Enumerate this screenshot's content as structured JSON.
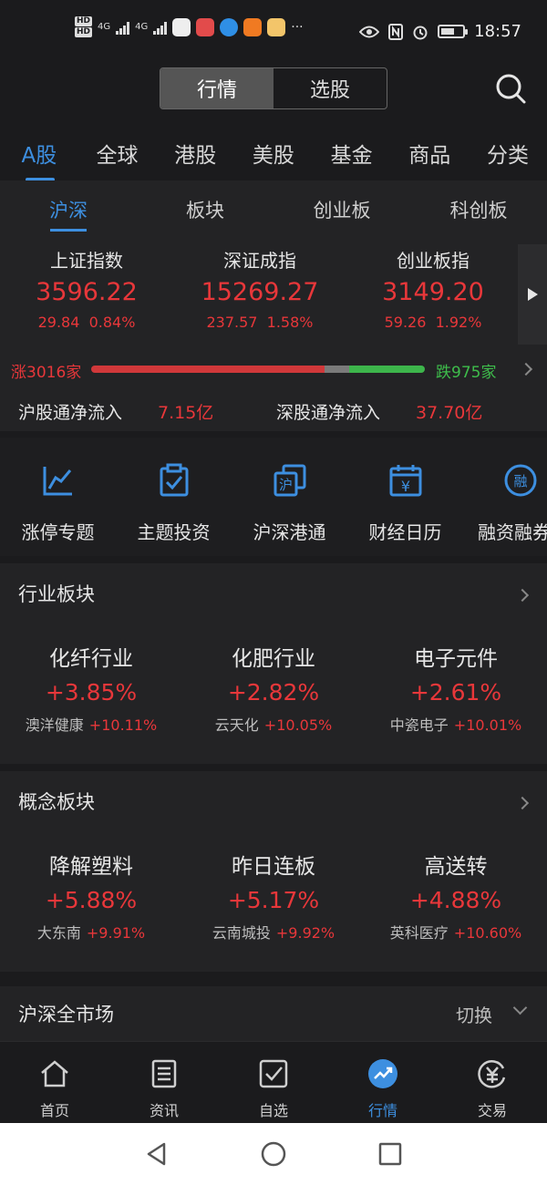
{
  "status_bar": {
    "hd1": "HD",
    "hd2": "HD",
    "net1": "4G",
    "net2": "4G",
    "time": "18:57",
    "dots": "···"
  },
  "header": {
    "segments": [
      "行情",
      "选股"
    ],
    "active_segment": 0
  },
  "main_tabs": [
    "A股",
    "全球",
    "港股",
    "美股",
    "基金",
    "商品",
    "分类"
  ],
  "sub_tabs": [
    "沪深",
    "板块",
    "创业板",
    "科创板"
  ],
  "indices": [
    {
      "name": "上证指数",
      "value": "3596.22",
      "change": "29.84",
      "pct": "0.84%"
    },
    {
      "name": "深证成指",
      "value": "15269.27",
      "change": "237.57",
      "pct": "1.58%"
    },
    {
      "name": "创业板指",
      "value": "3149.20",
      "change": "59.26",
      "pct": "1.92%"
    }
  ],
  "breadth": {
    "up_label": "涨3016家",
    "down_label": "跌975家",
    "up": 3016,
    "down": 975
  },
  "flows": {
    "sh_label": "沪股通净流入",
    "sh_value": "7.15亿",
    "sz_label": "深股通净流入",
    "sz_value": "37.70亿"
  },
  "shortcuts": [
    {
      "label": "涨停专题",
      "icon": "limit-up-chart-icon"
    },
    {
      "label": "主题投资",
      "icon": "clipboard-check-icon"
    },
    {
      "label": "沪深港通",
      "icon": "hk-connect-icon",
      "glyph": "沪"
    },
    {
      "label": "财经日历",
      "icon": "calendar-yen-icon",
      "glyph": "¥"
    },
    {
      "label": "融资融券",
      "icon": "margin-trading-icon",
      "glyph": "融"
    }
  ],
  "industry": {
    "title": "行业板块",
    "cards": [
      {
        "name": "化纤行业",
        "pct": "+3.85%",
        "leader": "澳洋健康",
        "leader_pct": "+10.11%"
      },
      {
        "name": "化肥行业",
        "pct": "+2.82%",
        "leader": "云天化",
        "leader_pct": "+10.05%"
      },
      {
        "name": "电子元件",
        "pct": "+2.61%",
        "leader": "中瓷电子",
        "leader_pct": "+10.01%"
      }
    ]
  },
  "concept": {
    "title": "概念板块",
    "cards": [
      {
        "name": "降解塑料",
        "pct": "+5.88%",
        "leader": "大东南",
        "leader_pct": "+9.91%"
      },
      {
        "name": "昨日连板",
        "pct": "+5.17%",
        "leader": "云南城投",
        "leader_pct": "+9.92%"
      },
      {
        "name": "高送转",
        "pct": "+4.88%",
        "leader": "英科医疗",
        "leader_pct": "+10.60%"
      }
    ]
  },
  "market": {
    "title": "沪深全市场",
    "switch_label": "切换"
  },
  "bottom_nav": [
    {
      "label": "首页",
      "icon": "home-icon"
    },
    {
      "label": "资讯",
      "icon": "news-icon"
    },
    {
      "label": "自选",
      "icon": "watchlist-icon"
    },
    {
      "label": "行情",
      "icon": "market-trend-icon"
    },
    {
      "label": "交易",
      "icon": "trade-yen-icon"
    }
  ],
  "colors": {
    "accent": "#3d8fe0",
    "up": "#e8373a",
    "down": "#3ebd4b",
    "background": "#1b1b1d",
    "panel": "#232325"
  }
}
